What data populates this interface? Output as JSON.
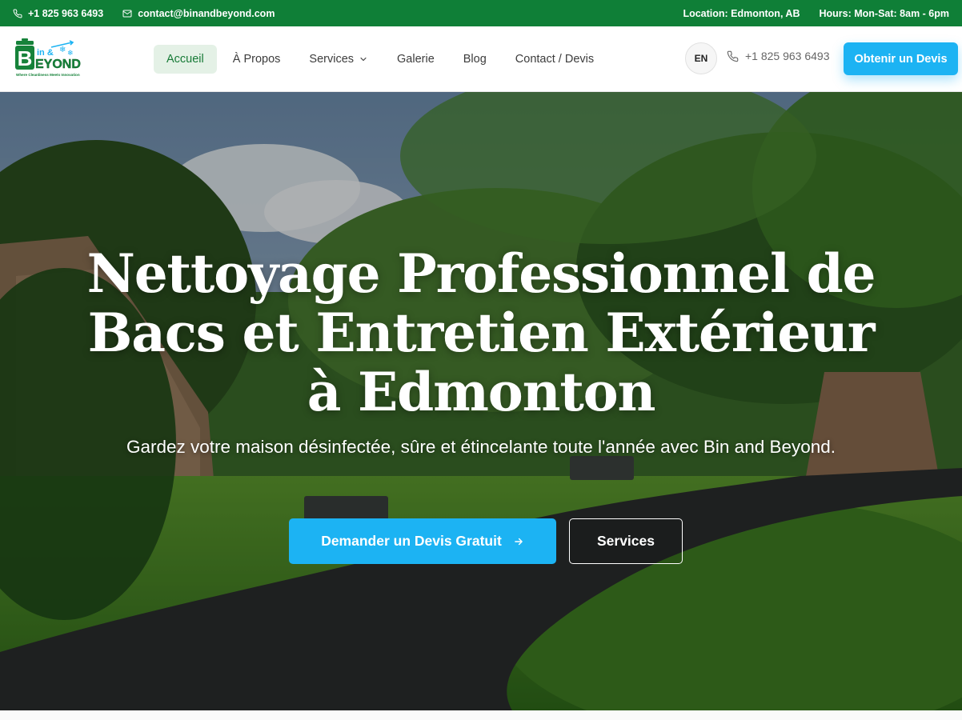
{
  "topbar": {
    "phone": "+1 825 963 6493",
    "email": "contact@binandbeyond.com",
    "location": "Location: Edmonton, AB",
    "hours": "Hours: Mon-Sat: 8am - 6pm",
    "background": "#0f7f37"
  },
  "header": {
    "logo": {
      "letter": "B",
      "word_top": "in &",
      "word_bottom": "EYOND",
      "tagline": "Where Cleanliness Meets Innovation"
    },
    "nav": [
      {
        "label": "Accueil",
        "active": true
      },
      {
        "label": "À Propos",
        "active": false
      },
      {
        "label": "Services",
        "active": false,
        "has_dropdown": true
      },
      {
        "label": "Galerie",
        "active": false
      },
      {
        "label": "Blog",
        "active": false
      },
      {
        "label": "Contact / Devis",
        "active": false
      }
    ],
    "lang_toggle": "EN",
    "phone": "+1 825 963 6493",
    "cta_label": "Obtenir un Devis",
    "accent": "#1cb3f3"
  },
  "hero": {
    "title": "Nettoyage Professionnel de Bacs et Entretien Extérieur à Edmonton",
    "subtitle": "Gardez votre maison désinfectée, sûre et étincelante toute l'année avec Bin and Beyond.",
    "primary_button": "Demander un Devis Gratuit",
    "secondary_button": "Services"
  },
  "icons": {
    "phone": "phone-icon",
    "email": "mail-icon",
    "dropdown": "chevron-down-icon",
    "arrow": "arrow-right-icon"
  }
}
